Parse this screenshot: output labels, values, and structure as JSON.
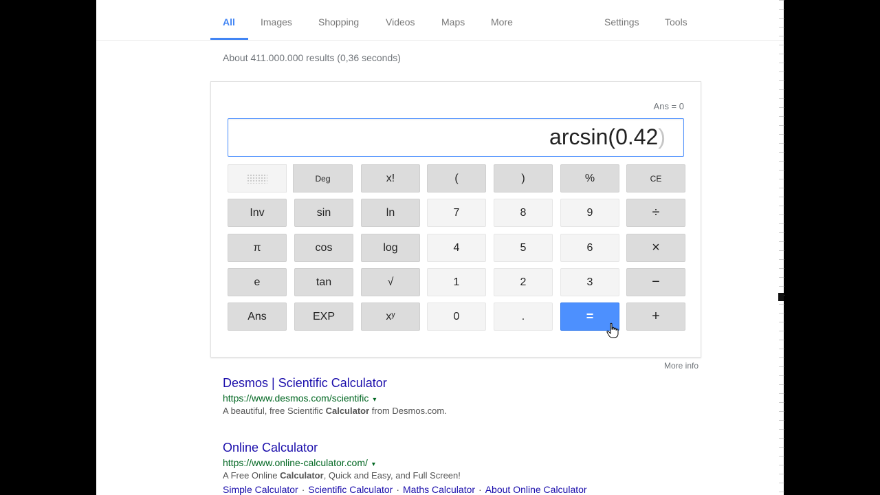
{
  "nav": {
    "tabs": [
      "All",
      "Images",
      "Shopping",
      "Videos",
      "Maps",
      "More"
    ],
    "settings": "Settings",
    "tools": "Tools"
  },
  "stats": "About 411.000.000 results (0,36 seconds)",
  "calculator": {
    "ans_line": "Ans = 0",
    "display": "arcsin(0.42",
    "display_closing": ")",
    "angle_mode": "Deg",
    "keys": {
      "row1": [
        "x!",
        "(",
        ")",
        "%",
        "CE"
      ],
      "row2": [
        "Inv",
        "sin",
        "ln",
        "7",
        "8",
        "9",
        "÷"
      ],
      "row3": [
        "π",
        "cos",
        "log",
        "4",
        "5",
        "6",
        "×"
      ],
      "row4": [
        "e",
        "tan",
        "√",
        "1",
        "2",
        "3",
        "−"
      ],
      "row5": [
        "Ans",
        "EXP",
        "xʸ",
        "0",
        ".",
        "=",
        "+"
      ]
    },
    "accent_color": "#4d90fe"
  },
  "more_info": "More info",
  "results": [
    {
      "title": "Desmos | Scientific Calculator",
      "url": "https://www.desmos.com/scientific",
      "snippet_pre": "A beautiful, free Scientific ",
      "snippet_bold": "Calculator",
      "snippet_post": " from Desmos.com."
    },
    {
      "title": "Online Calculator",
      "url": "https://www.online-calculator.com/",
      "snippet_pre": "A Free Online ",
      "snippet_bold": "Calculator",
      "snippet_post": ", Quick and Easy, and Full Screen!",
      "sitelinks": [
        "Simple Calculator",
        "Scientific Calculator",
        "Maths Calculator",
        "About Online Calculator"
      ]
    }
  ],
  "icons": {
    "url_caret": "▾",
    "cursor": "hand-pointer-icon"
  }
}
